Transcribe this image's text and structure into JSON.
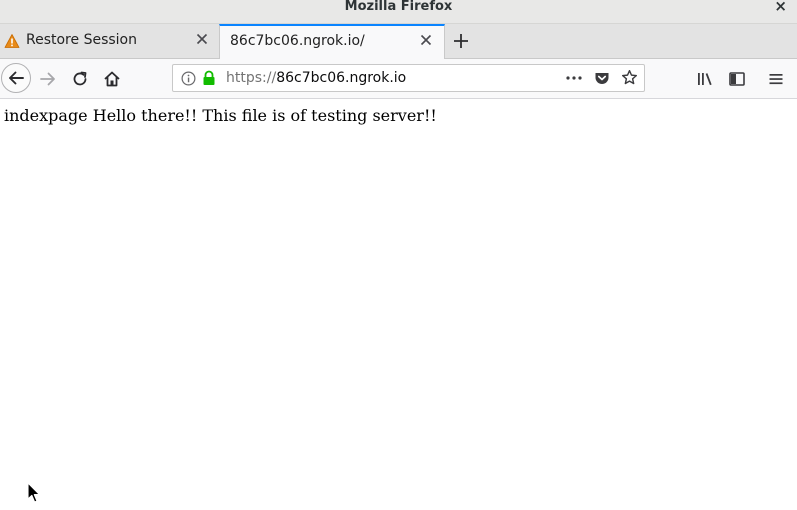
{
  "window": {
    "title": "Mozilla Firefox",
    "close_glyph": "×"
  },
  "tabs": [
    {
      "label": "Restore Session",
      "icon": "warning-icon",
      "active": false
    },
    {
      "label": "86c7bc06.ngrok.io/",
      "active": true
    }
  ],
  "navbar": {
    "url_scheme": "https://",
    "url_host": "86c7bc06.ngrok.io",
    "icons": [
      "back-icon",
      "forward-icon",
      "reload-icon",
      "home-icon",
      "info-icon",
      "lock-icon",
      "page-actions-icon",
      "pocket-icon",
      "bookmark-star-icon",
      "library-icon",
      "sidebar-icon",
      "menu-icon"
    ]
  },
  "page": {
    "body_text": "indexpage Hello there!! This file is of testing server!!"
  },
  "colors": {
    "accent": "#0a84ff",
    "lock_green": "#12bc00",
    "warning_orange": "#e88b1a"
  }
}
